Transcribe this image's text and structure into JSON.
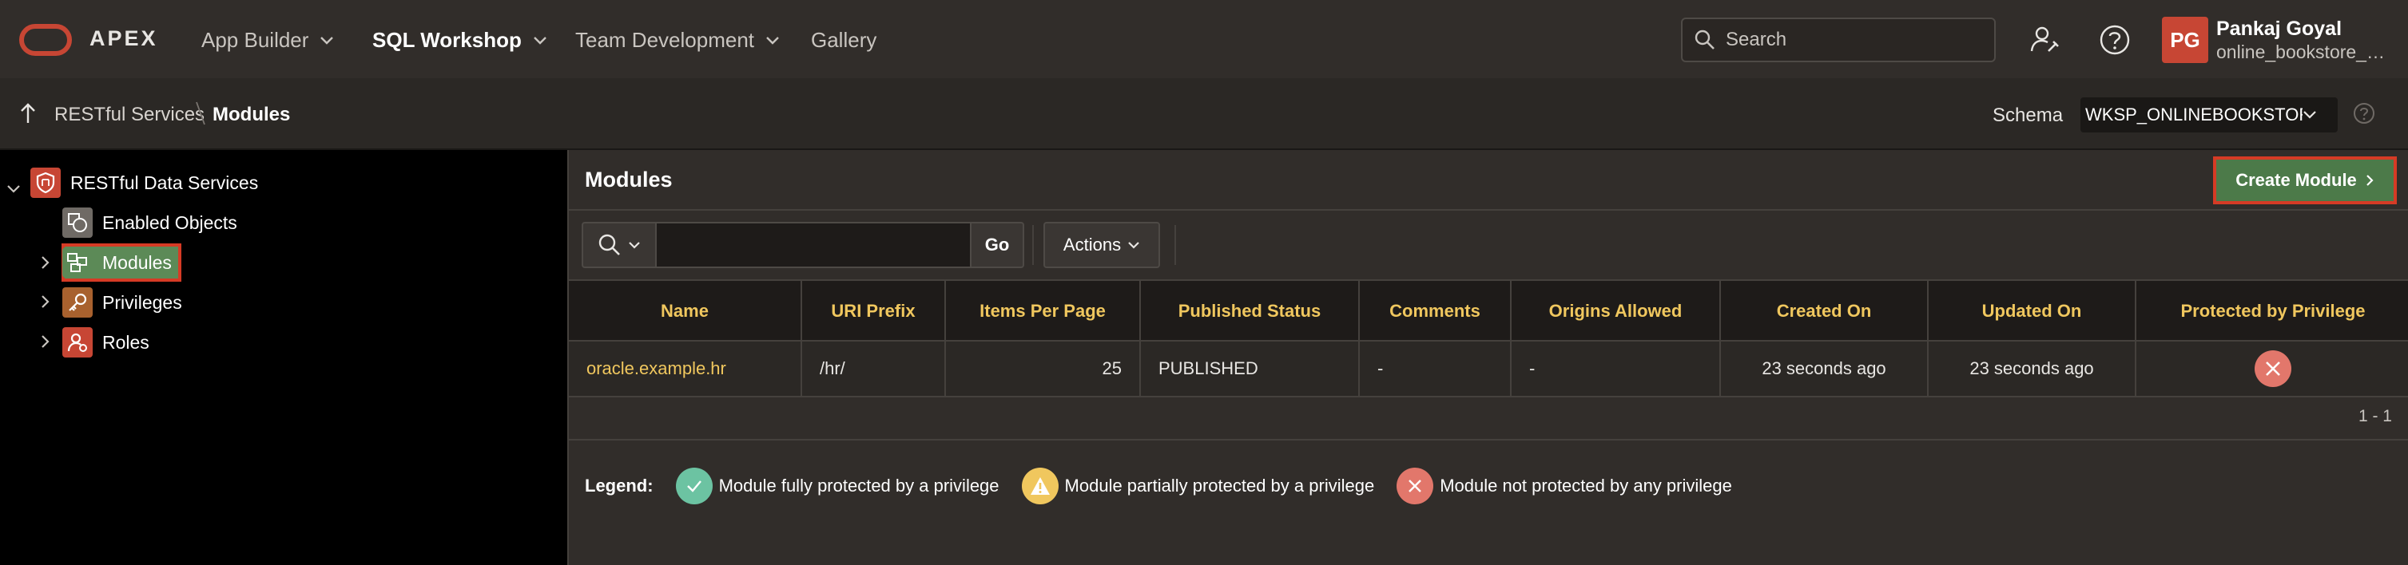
{
  "header": {
    "brand": "APEX",
    "nav": [
      {
        "label": "App Builder"
      },
      {
        "label": "SQL Workshop"
      },
      {
        "label": "Team Development"
      },
      {
        "label": "Gallery"
      }
    ],
    "search_placeholder": "Search",
    "user": {
      "initials": "PG",
      "name": "Pankaj Goyal",
      "workspace": "online_bookstore_a..."
    }
  },
  "breadcrumb": {
    "parent": "RESTful Services",
    "current": "Modules"
  },
  "schema": {
    "label": "Schema",
    "value": "WKSP_ONLINEBOOKSTORE"
  },
  "tree": {
    "root": "RESTful Data Services",
    "items": [
      {
        "label": "Enabled Objects"
      },
      {
        "label": "Modules"
      },
      {
        "label": "Privileges"
      },
      {
        "label": "Roles"
      }
    ]
  },
  "region": {
    "title": "Modules",
    "create_button": "Create Module"
  },
  "toolbar": {
    "search_value": "",
    "go_label": "Go",
    "actions_label": "Actions"
  },
  "grid": {
    "columns": [
      "Name",
      "URI Prefix",
      "Items Per Page",
      "Published Status",
      "Comments",
      "Origins Allowed",
      "Created On",
      "Updated On",
      "Protected by Privilege"
    ],
    "rows": [
      {
        "name": "oracle.example.hr",
        "uri_prefix": "/hr/",
        "items_per_page": "25",
        "published_status": "PUBLISHED",
        "comments": "-",
        "origins_allowed": "-",
        "created_on": "23 seconds ago",
        "updated_on": "23 seconds ago",
        "protected_icon": "x-circle-icon"
      }
    ],
    "pagination": "1 - 1"
  },
  "legend": {
    "title": "Legend:",
    "items": [
      {
        "icon": "check-circle-icon",
        "color": "#6cc3a2",
        "label": "Module fully protected by a privilege"
      },
      {
        "icon": "warning-circle-icon",
        "color": "#f0c75e",
        "label": "Module partially protected by a privilege"
      },
      {
        "icon": "x-circle-icon",
        "color": "#e2776b",
        "label": "Module not protected by any privilege"
      }
    ]
  },
  "colors": {
    "brand_red": "#c74634",
    "accent_green": "#4c7a49",
    "link_yellow": "#f0c75e",
    "header_bg": "#312d2a"
  }
}
